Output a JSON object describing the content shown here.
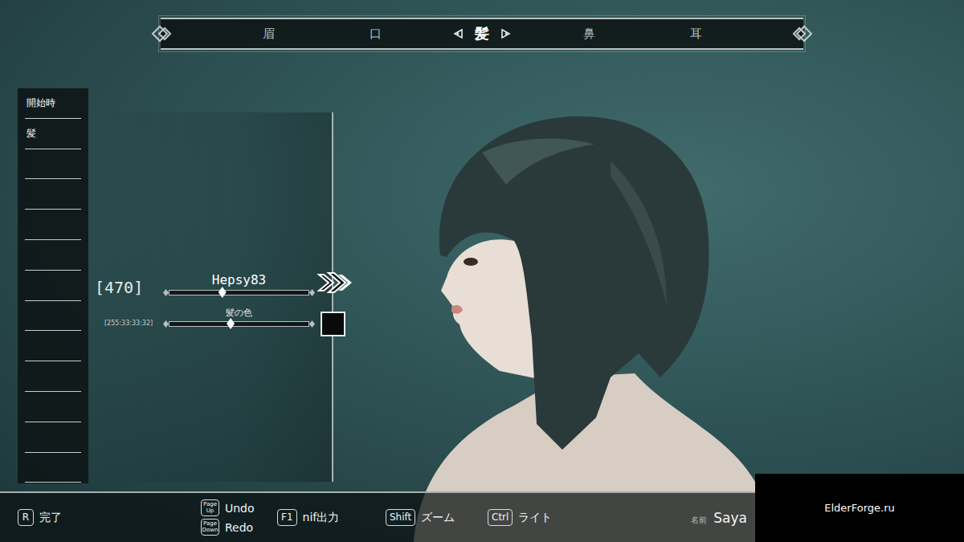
{
  "top_tabs": [
    {
      "label": "眉",
      "selected": false
    },
    {
      "label": "口",
      "selected": false
    },
    {
      "label": "髪",
      "selected": true
    },
    {
      "label": "鼻",
      "selected": false
    },
    {
      "label": "耳",
      "selected": false
    }
  ],
  "sidebar": {
    "items": [
      {
        "label": "開始時"
      },
      {
        "label": "髪"
      }
    ]
  },
  "sliders": [
    {
      "kind": "option",
      "label": "Hepsy83",
      "count": "[470]",
      "level": 0.38
    },
    {
      "kind": "color",
      "label": "髪の色",
      "reading": "[255:33:33:32]",
      "level": 0.44,
      "color": "#0a0a0a"
    }
  ],
  "controls": [
    {
      "kind": "single",
      "key": "R",
      "label": "完了"
    },
    {
      "kind": "stack",
      "rows": [
        {
          "key": "Page Up",
          "label": "Undo"
        },
        {
          "key": "Page Down",
          "label": "Redo"
        }
      ]
    },
    {
      "kind": "single",
      "key": "F1",
      "label": "nif出力"
    },
    {
      "kind": "single",
      "key": "Shift",
      "label": "ズーム"
    },
    {
      "kind": "single",
      "key": "Ctrl",
      "label": "ライト"
    }
  ],
  "name": {
    "label": "名前",
    "value": "Saya"
  },
  "watermark": "ElderForge.ru"
}
